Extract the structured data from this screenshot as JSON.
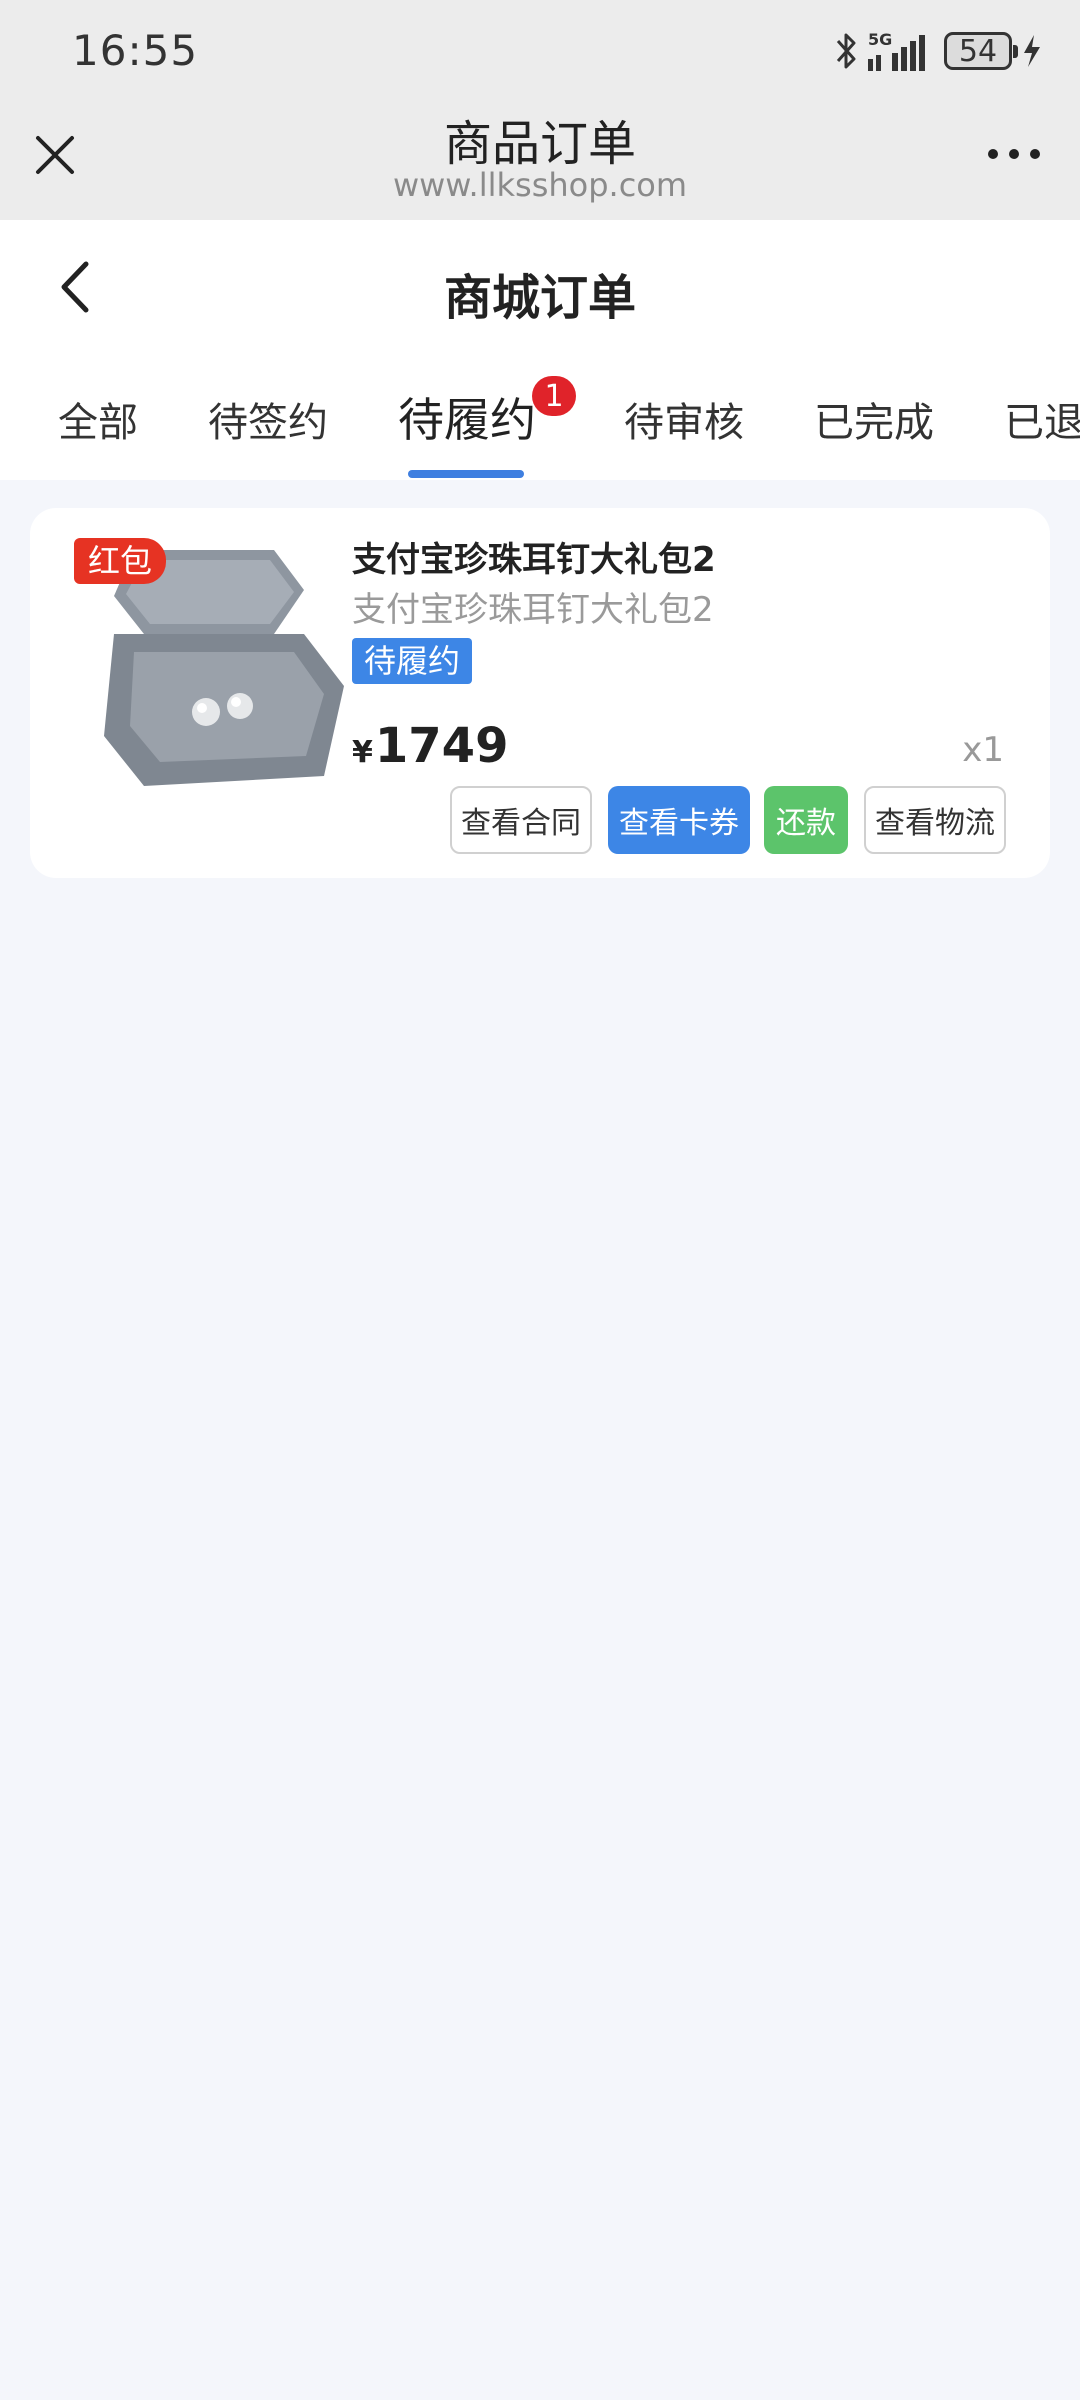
{
  "status_bar": {
    "time": "16:55",
    "network": "5G",
    "battery": "54"
  },
  "browser": {
    "title": "商品订单",
    "url": "www.llksshop.com"
  },
  "page": {
    "title": "商城订单"
  },
  "tabs": [
    {
      "label": "全部"
    },
    {
      "label": "待签约"
    },
    {
      "label": "待履约",
      "badge": "1",
      "active": true
    },
    {
      "label": "待审核"
    },
    {
      "label": "已完成"
    },
    {
      "label": "已退"
    }
  ],
  "order": {
    "tag": "红包",
    "name": "支付宝珍珠耳钉大礼包2",
    "subtitle": "支付宝珍珠耳钉大礼包2",
    "status": "待履约",
    "currency": "¥",
    "price": "1749",
    "quantity": "x1",
    "buttons": {
      "contract": "查看合同",
      "coupon": "查看卡券",
      "repay": "还款",
      "logistics": "查看物流"
    }
  },
  "colors": {
    "accent_blue": "#3d86e6",
    "badge_red": "#e0232a",
    "tag_red": "#e63323",
    "green": "#5cc46b",
    "page_bg": "#f4f6fb"
  }
}
